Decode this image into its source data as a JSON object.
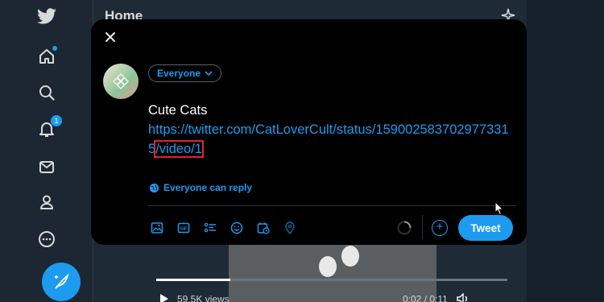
{
  "colors": {
    "accent": "#1d9bf0",
    "background": "#15202b",
    "modal": "#000000",
    "highlight_box": "#e0232e"
  },
  "nav": {
    "icons": [
      "twitter-bird-icon",
      "home-icon",
      "explore-icon",
      "notifications-icon",
      "messages-icon",
      "profile-icon",
      "more-icon"
    ],
    "notifications_badge": "1",
    "compose_icon": "feather-icon"
  },
  "timeline": {
    "title": "Home",
    "video": {
      "views": "59.5K views",
      "time": "0:02 / 0:11",
      "progress": 0.21
    }
  },
  "composer": {
    "close_icon": "close-icon",
    "audience_label": "Everyone",
    "tweet_title": "Cute Cats",
    "link_prefix": "https://twitter.com/CatLoverCult/status/1590025837029773315",
    "link_highlight": "/video/1",
    "reply_setting": "Everyone can reply",
    "toolbar": [
      "media-icon",
      "gif-icon",
      "poll-icon",
      "emoji-icon",
      "schedule-icon",
      "location-icon"
    ],
    "add_thread": "+",
    "tweet_button": "Tweet"
  }
}
